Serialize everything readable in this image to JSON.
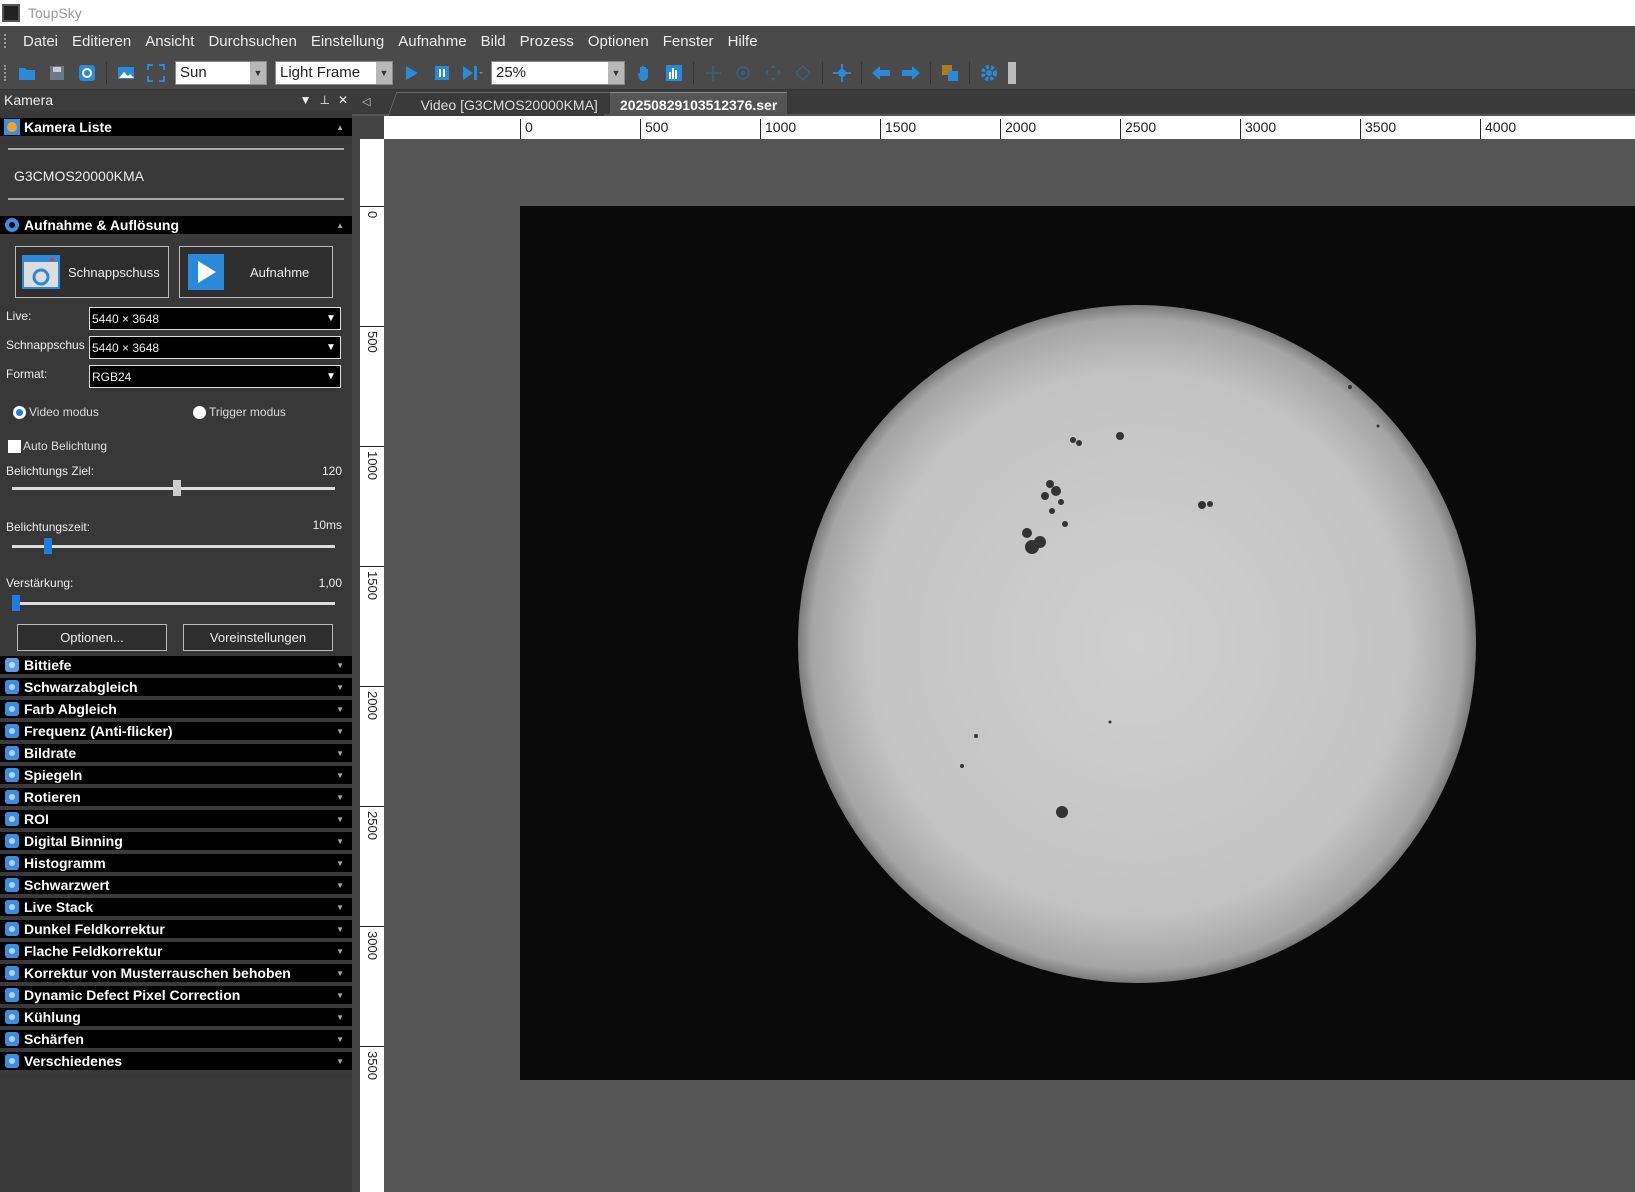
{
  "window": {
    "title": "ToupSky"
  },
  "menu": [
    "Datei",
    "Editieren",
    "Ansicht",
    "Durchsuchen",
    "Einstellung",
    "Aufnahme",
    "Bild",
    "Prozess",
    "Optionen",
    "Fenster",
    "Hilfe"
  ],
  "toolbar": {
    "profile_value": "Sun",
    "frame_type_value": "Light Frame",
    "zoom_value": "25%"
  },
  "panel": {
    "title": "Kamera",
    "camera_list": {
      "header": "Kamera Liste",
      "camera": "G3CMOS20000KMA"
    },
    "capture": {
      "header": "Aufnahme & Auflösung",
      "snapshot_label": "Schnappschuss",
      "record_label": "Aufnahme",
      "live_label": "Live:",
      "live_value": "5440 × 3648",
      "snap_label": "Schnappschus",
      "snap_value": "5440 × 3648",
      "format_label": "Format:",
      "format_value": "RGB24",
      "video_mode": "Video modus",
      "trigger_mode": "Trigger modus",
      "auto_exposure": "Auto Belichtung",
      "exposure_target_label": "Belichtungs Ziel:",
      "exposure_target_value": "120",
      "exposure_target_fraction": 0.51,
      "exposure_time_label": "Belichtungszeit:",
      "exposure_time_value": "10ms",
      "exposure_time_fraction": 0.1,
      "gain_label": "Verstärkung:",
      "gain_value": "1,00",
      "gain_fraction": 0.0,
      "options_label": "Optionen...",
      "presets_label": "Voreinstellungen"
    },
    "sections": [
      {
        "label": "Bittiefe",
        "icon": "bitdepth-icon",
        "color": "#5a9ee0"
      },
      {
        "label": "Schwarzabgleich",
        "icon": "half-circle-icon",
        "color": "#3b8fe0"
      },
      {
        "label": "Farb Abgleich",
        "icon": "palette-icon",
        "color": "#3b8fe0"
      },
      {
        "label": "Frequenz (Anti-flicker)",
        "icon": "bulb-icon",
        "color": "#3b8fe0"
      },
      {
        "label": "Bildrate",
        "icon": "lightning-icon",
        "color": "#3b8fe0"
      },
      {
        "label": "Spiegeln",
        "icon": "mirror-icon",
        "color": "#3b8fe0"
      },
      {
        "label": "Rotieren",
        "icon": "rotate-icon",
        "color": "#3b8fe0"
      },
      {
        "label": "ROI",
        "icon": "crop-icon",
        "color": "#3b8fe0"
      },
      {
        "label": "Digital Binning",
        "icon": "binning-icon",
        "color": "#3b8fe0"
      },
      {
        "label": "Histogramm",
        "icon": "histogram-icon",
        "color": "#3b8fe0"
      },
      {
        "label": "Schwarzwert",
        "icon": "sliders-icon",
        "color": "#3b8fe0"
      },
      {
        "label": "Live Stack",
        "icon": "layers-icon",
        "color": "#3b8fe0"
      },
      {
        "label": "Dunkel Feldkorrektur",
        "icon": "minus-circle-icon",
        "color": "#3b8fe0"
      },
      {
        "label": "Flache Feldkorrektur",
        "icon": "equal-circle-icon",
        "color": "#3b8fe0"
      },
      {
        "label": "Korrektur von Musterrauschen behoben",
        "icon": "pattern-icon",
        "color": "#3b8fe0"
      },
      {
        "label": "Dynamic Defect Pixel Correction",
        "icon": "checker-icon",
        "color": "#3b8fe0"
      },
      {
        "label": "Kühlung",
        "icon": "snowflake-icon",
        "color": "#3b8fe0"
      },
      {
        "label": "Schärfen",
        "icon": "triangle-icon",
        "color": "#3b8fe0"
      },
      {
        "label": "Verschiedenes",
        "icon": "asterisk-icon",
        "color": "#3b8fe0"
      }
    ]
  },
  "tabs": [
    {
      "label": "Video [G3CMOS20000KMA]",
      "active": false
    },
    {
      "label": "20250829103512376.ser",
      "active": true
    }
  ],
  "ruler_h": [
    "0",
    "500",
    "1000",
    "1500",
    "2000",
    "2500",
    "3000",
    "3500",
    "4000"
  ],
  "ruler_v": [
    "0",
    "500",
    "1000",
    "1500",
    "2000",
    "2500",
    "3000",
    "3500"
  ],
  "colors": {
    "accent": "#1e7be0",
    "panel_bg": "#383838",
    "section_header": "#000000"
  }
}
